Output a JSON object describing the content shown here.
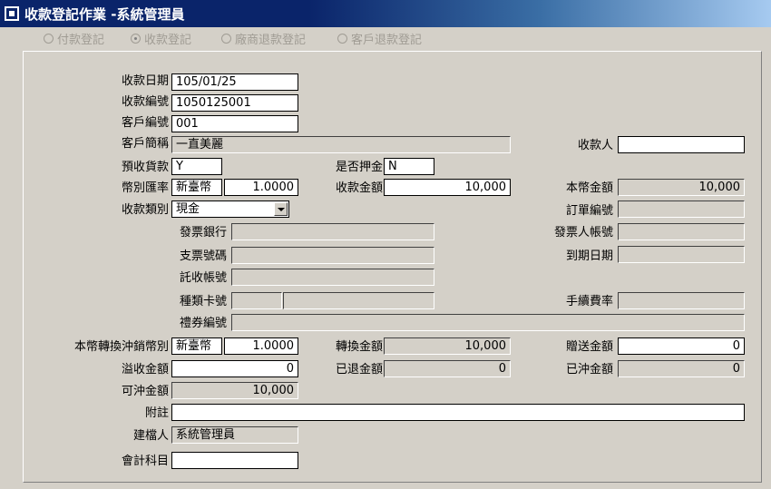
{
  "window": {
    "title": "收款登記作業 -系統管理員"
  },
  "mode_radios": [
    {
      "label": "付款登記",
      "selected": false
    },
    {
      "label": "收款登記",
      "selected": true
    },
    {
      "label": "廠商退款登記",
      "selected": false
    },
    {
      "label": "客戶退款登記",
      "selected": false
    }
  ],
  "form": {
    "receipt_date": {
      "label": "收款日期",
      "value": "105/01/25"
    },
    "receipt_no": {
      "label": "收款編號",
      "value": "1050125001"
    },
    "customer_no": {
      "label": "客戶編號",
      "value": "001"
    },
    "customer_name": {
      "label": "客戶簡稱",
      "value": "一直美麗"
    },
    "payee": {
      "label": "收款人",
      "value": ""
    },
    "prepayment": {
      "label": "預收貨款",
      "value": "Y"
    },
    "is_deposit": {
      "label": "是否押金",
      "value": "N"
    },
    "currency_rate": {
      "label": "幣別匯率",
      "currency": "新臺幣",
      "rate": "1.0000"
    },
    "receipt_amount": {
      "label": "收款金額",
      "value": "10,000"
    },
    "local_amount": {
      "label": "本幣金額",
      "value": "10,000"
    },
    "receipt_type": {
      "label": "收款類別",
      "value": "現金"
    },
    "order_no": {
      "label": "訂單編號",
      "value": ""
    },
    "issuing_bank": {
      "label": "發票銀行",
      "value": ""
    },
    "issuer_account": {
      "label": "發票人帳號",
      "value": ""
    },
    "check_no": {
      "label": "支票號碼",
      "value": ""
    },
    "due_date": {
      "label": "到期日期",
      "value": ""
    },
    "collection_account": {
      "label": "託收帳號",
      "value": ""
    },
    "card_type_no": {
      "label": "種類卡號",
      "type": "",
      "number": ""
    },
    "handling_fee_rate": {
      "label": "手續費率",
      "value": ""
    },
    "voucher_no": {
      "label": "禮券編號",
      "value": ""
    },
    "offset_currency": {
      "label": "本幣轉換沖銷幣別",
      "currency": "新臺幣",
      "rate": "1.0000"
    },
    "converted_amount": {
      "label": "轉換金額",
      "value": "10,000"
    },
    "gift_amount": {
      "label": "贈送金額",
      "value": "0"
    },
    "overpaid_amount": {
      "label": "溢收金額",
      "value": "0"
    },
    "refunded_amount": {
      "label": "已退金額",
      "value": "0"
    },
    "offset_amount": {
      "label": "已沖金額",
      "value": "0"
    },
    "available_offset": {
      "label": "可沖金額",
      "value": "10,000"
    },
    "remarks": {
      "label": "附註",
      "value": ""
    },
    "created_by": {
      "label": "建檔人",
      "value": "系統管理員"
    },
    "account_subject": {
      "label": "會計科目",
      "value": ""
    }
  }
}
